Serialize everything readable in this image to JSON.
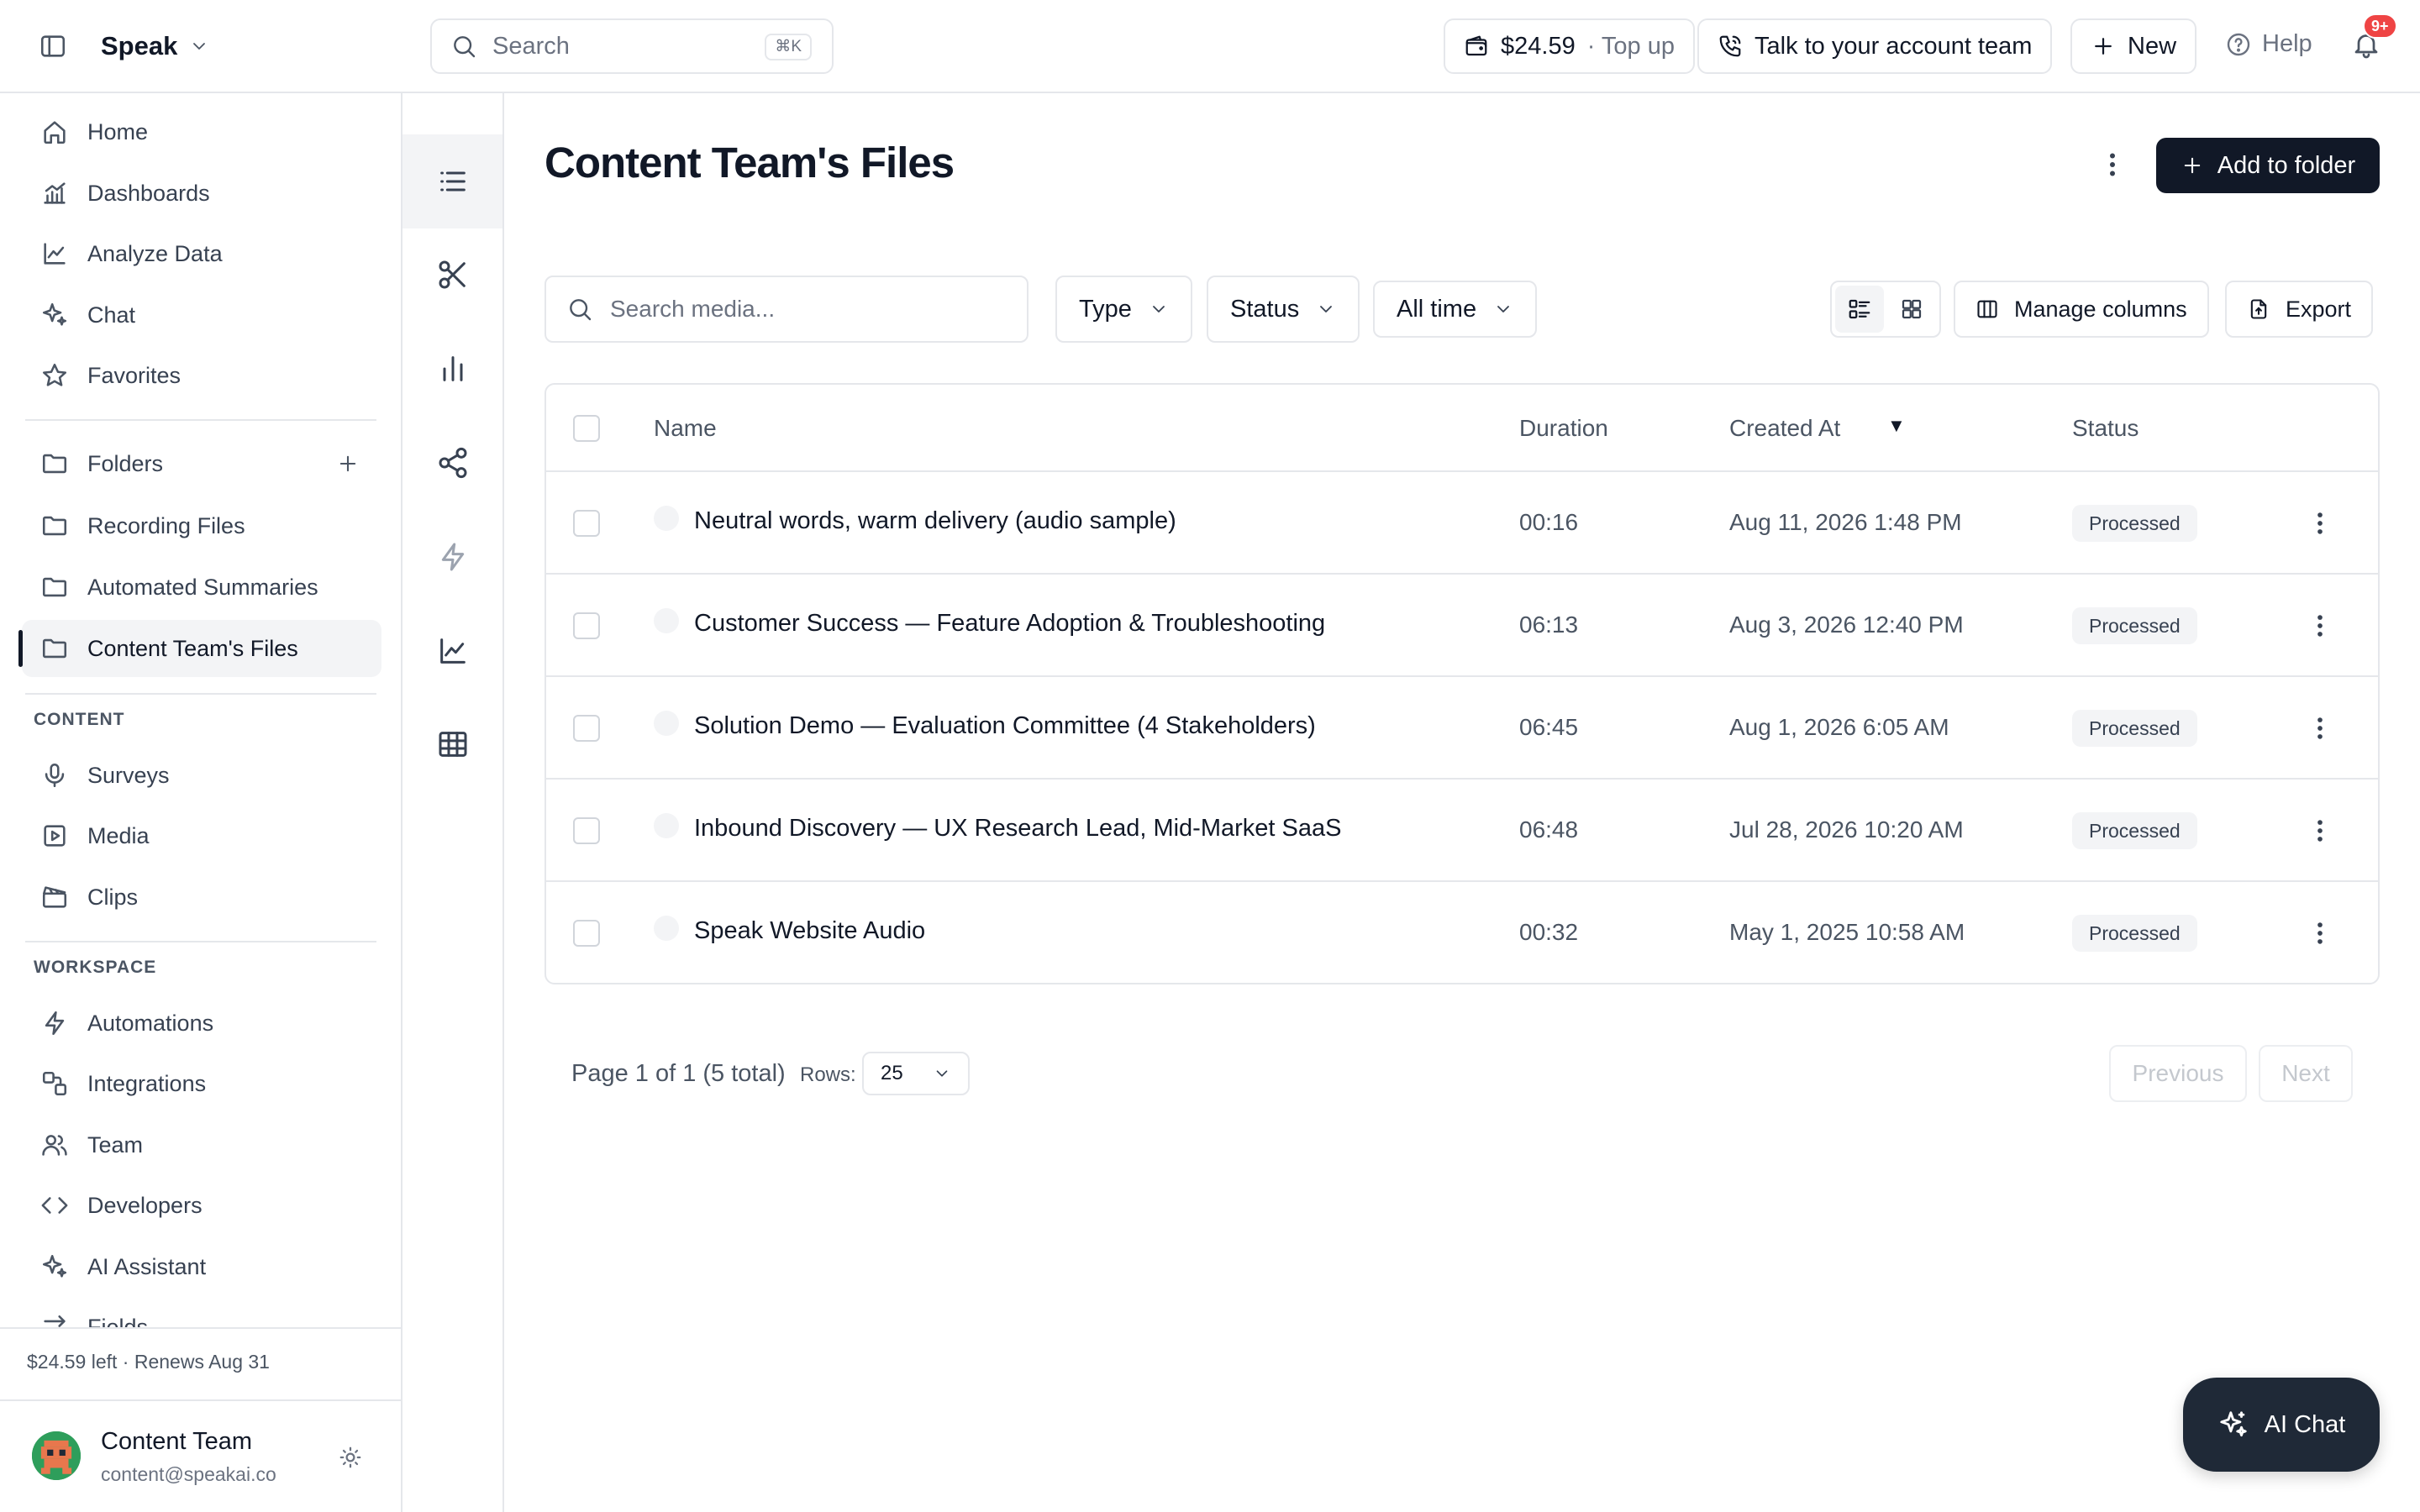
{
  "topbar": {
    "brand": "Speak",
    "search_placeholder": "Search",
    "search_shortcut": "⌘K",
    "balance": "$24.59",
    "topup": "· Top up",
    "talk_label": "Talk to your account team",
    "new_label": "New",
    "help_label": "Help",
    "notif_count": "9+"
  },
  "sidebar": {
    "main": [
      {
        "label": "Home",
        "icon": "home-icon"
      },
      {
        "label": "Dashboards",
        "icon": "dashboard-icon"
      },
      {
        "label": "Analyze Data",
        "icon": "line-chart-icon"
      },
      {
        "label": "Chat",
        "icon": "sparkles-icon"
      },
      {
        "label": "Favorites",
        "icon": "star-icon"
      }
    ],
    "folders": [
      {
        "label": "Folders",
        "icon": "folder-icon"
      },
      {
        "label": "Recording Files",
        "icon": "folder-icon"
      },
      {
        "label": "Automated Summaries",
        "icon": "folder-icon"
      },
      {
        "label": "Content Team's Files",
        "icon": "folder-icon",
        "active": true
      }
    ],
    "content_label": "CONTENT",
    "content": [
      {
        "label": "Surveys",
        "icon": "microphone-icon"
      },
      {
        "label": "Media",
        "icon": "play-square-icon"
      },
      {
        "label": "Clips",
        "icon": "clapperboard-icon"
      }
    ],
    "workspace_label": "WORKSPACE",
    "workspace": [
      {
        "label": "Automations",
        "icon": "bolt-icon"
      },
      {
        "label": "Integrations",
        "icon": "integrations-icon"
      },
      {
        "label": "Team",
        "icon": "users-icon"
      },
      {
        "label": "Developers",
        "icon": "code-icon"
      },
      {
        "label": "AI Assistant",
        "icon": "sparkles-icon"
      },
      {
        "label": "Fields",
        "icon": "fields-icon"
      }
    ],
    "credits": "$24.59 left · Renews Aug 31",
    "user_name": "Content Team",
    "user_email": "content@speakai.co"
  },
  "main": {
    "title": "Content Team's Files",
    "add_folder_label": "Add to folder",
    "search_placeholder": "Search media...",
    "filters": {
      "type": "Type",
      "status": "Status",
      "time": "All time"
    },
    "manage_columns": "Manage columns",
    "export": "Export",
    "columns": {
      "name": "Name",
      "duration": "Duration",
      "created": "Created At",
      "status": "Status"
    },
    "rows": [
      {
        "name": "Neutral words, warm delivery (audio sample)",
        "duration": "00:16",
        "created": "Aug 11, 2026 1:48 PM",
        "status": "Processed"
      },
      {
        "name": "Customer Success — Feature Adoption & Troubleshooting",
        "duration": "06:13",
        "created": "Aug 3, 2026 12:40 PM",
        "status": "Processed"
      },
      {
        "name": "Solution Demo — Evaluation Committee (4 Stakeholders)",
        "duration": "06:45",
        "created": "Aug 1, 2026 6:05 AM",
        "status": "Processed"
      },
      {
        "name": "Inbound Discovery — UX Research Lead, Mid-Market SaaS",
        "duration": "06:48",
        "created": "Jul 28, 2026 10:20 AM",
        "status": "Processed"
      },
      {
        "name": "Speak Website Audio",
        "duration": "00:32",
        "created": "May 1, 2025 10:58 AM",
        "status": "Processed"
      }
    ],
    "pagination": {
      "text": "Page 1 of 1 (5 total)",
      "rows_label": "Rows:",
      "rows_value": "25",
      "previous": "Previous",
      "next": "Next"
    }
  },
  "ai_chat": "AI Chat"
}
